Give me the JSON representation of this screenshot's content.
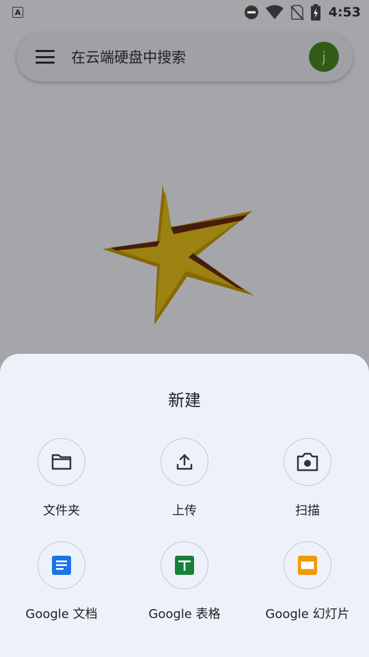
{
  "status_bar": {
    "notification_icon": "accessibility-a-icon",
    "time": "4:53",
    "icons": [
      "do-not-disturb-icon",
      "wifi-icon",
      "no-sim-icon",
      "battery-icon"
    ]
  },
  "search_bar": {
    "menu_icon": "menu-icon",
    "placeholder": "在云端硬盘中搜索",
    "avatar_letter": "j",
    "avatar_color": "#4a8a22"
  },
  "sheet": {
    "title": "新建",
    "actions": [
      {
        "label": "文件夹",
        "icon": "folder-icon"
      },
      {
        "label": "上传",
        "icon": "upload-icon"
      },
      {
        "label": "扫描",
        "icon": "camera-icon"
      },
      {
        "label": "Google 文档",
        "icon": "google-docs-icon",
        "color": "#1a73e8"
      },
      {
        "label": "Google 表格",
        "icon": "google-sheets-icon",
        "color": "#188038"
      },
      {
        "label": "Google 幻灯片",
        "icon": "google-slides-icon",
        "color": "#f29900"
      }
    ]
  }
}
